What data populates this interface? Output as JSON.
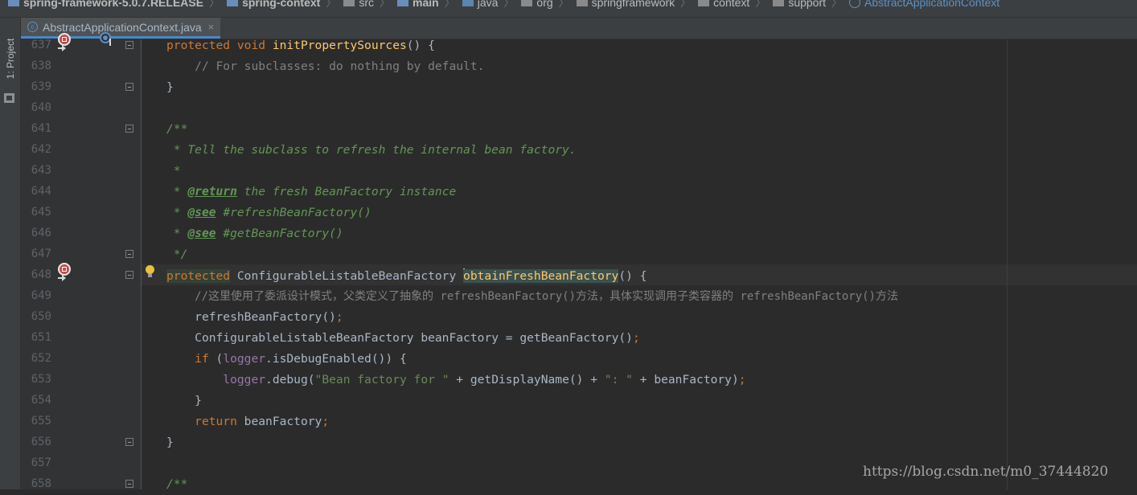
{
  "breadcrumb": [
    {
      "label": "spring-framework-5.0.7.RELEASE",
      "icon": "module-icon",
      "bold": true
    },
    {
      "label": "spring-context",
      "icon": "module-icon",
      "bold": true
    },
    {
      "label": "src",
      "icon": "folder-icon"
    },
    {
      "label": "main",
      "icon": "module-icon",
      "bold": true
    },
    {
      "label": "java",
      "icon": "source-folder-icon"
    },
    {
      "label": "org",
      "icon": "package-icon"
    },
    {
      "label": "springframework",
      "icon": "package-icon"
    },
    {
      "label": "context",
      "icon": "package-icon"
    },
    {
      "label": "support",
      "icon": "package-icon"
    },
    {
      "label": "AbstractApplicationContext",
      "icon": "class-icon",
      "active": true
    }
  ],
  "sidebar": {
    "project_tab_label": "1: Project"
  },
  "editor_tab": {
    "title": "AbstractApplicationContext.java",
    "close_glyph": "×",
    "icon": "class-icon"
  },
  "code": {
    "current_line": 648,
    "lines": [
      {
        "num": "637",
        "text": "protected void initPropertySources() {"
      },
      {
        "num": "638",
        "text": "    // For subclasses: do nothing by default."
      },
      {
        "num": "639",
        "text": "}"
      },
      {
        "num": "640",
        "text": ""
      },
      {
        "num": "641",
        "text": "/**"
      },
      {
        "num": "642",
        "text": " * Tell the subclass to refresh the internal bean factory."
      },
      {
        "num": "643",
        "text": " *"
      },
      {
        "num": "644",
        "text": " * @return the fresh BeanFactory instance"
      },
      {
        "num": "645",
        "text": " * @see #refreshBeanFactory()"
      },
      {
        "num": "646",
        "text": " * @see #getBeanFactory()"
      },
      {
        "num": "647",
        "text": " */"
      },
      {
        "num": "648",
        "text": "protected ConfigurableListableBeanFactory obtainFreshBeanFactory() {"
      },
      {
        "num": "649",
        "text": "    //这里使用了委派设计模式，父类定义了抽象的 refreshBeanFactory()方法，具体实现调用子类容器的 refreshBeanFactory()方法"
      },
      {
        "num": "650",
        "text": "    refreshBeanFactory();"
      },
      {
        "num": "651",
        "text": "    ConfigurableListableBeanFactory beanFactory = getBeanFactory();"
      },
      {
        "num": "652",
        "text": "    if (logger.isDebugEnabled()) {"
      },
      {
        "num": "653",
        "text": "        logger.debug(\"Bean factory for \" + getDisplayName() + \": \" + beanFactory);"
      },
      {
        "num": "654",
        "text": "    }"
      },
      {
        "num": "655",
        "text": "    return beanFactory;"
      },
      {
        "num": "656",
        "text": "}"
      },
      {
        "num": "657",
        "text": ""
      },
      {
        "num": "658",
        "text": "/**"
      }
    ]
  },
  "tokens": {
    "protected": "protected",
    "void": "void",
    "init_method": "initPropertySources",
    "cfg_type": "ConfigurableListableBeanFactory",
    "obtain_method": "obtainFreshBeanFactory",
    "comment_638": "// For subclasses: do nothing by default.",
    "doc_open": "/**",
    "doc_642": " * Tell the subclass to refresh the internal bean factory.",
    "doc_star": " *",
    "doc_return_tag": "@return",
    "doc_return_text": " the fresh BeanFactory instance",
    "doc_see_tag": "@see",
    "doc_see_1": " #refreshBeanFactory()",
    "doc_see_2": " #getBeanFactory()",
    "doc_close": " */",
    "comment_649": "//这里使用了委派设计模式，父类定义了抽象的 refreshBeanFactory()方法，具体实现调用子类容器的 refreshBeanFactory()方法",
    "refresh_call": "refreshBeanFactory",
    "bean_factory_var": "beanFactory",
    "get_bean_factory_call": "getBeanFactory",
    "if": "if",
    "logger": "logger",
    "is_debug": "isDebugEnabled",
    "debug": "debug",
    "str_bean_factory_for": "\"Bean factory for \"",
    "get_display_name": "getDisplayName",
    "str_colon": "\": \"",
    "return": "return"
  },
  "watermark": "https://blog.csdn.net/m0_37444820",
  "colors": {
    "background": "#2b2b2b",
    "keyword": "#cc7832",
    "method": "#ffc66d",
    "field": "#9876aa",
    "string": "#6a8759",
    "comment": "#808080",
    "doc_comment": "#629755",
    "text": "#a9b7c6"
  }
}
